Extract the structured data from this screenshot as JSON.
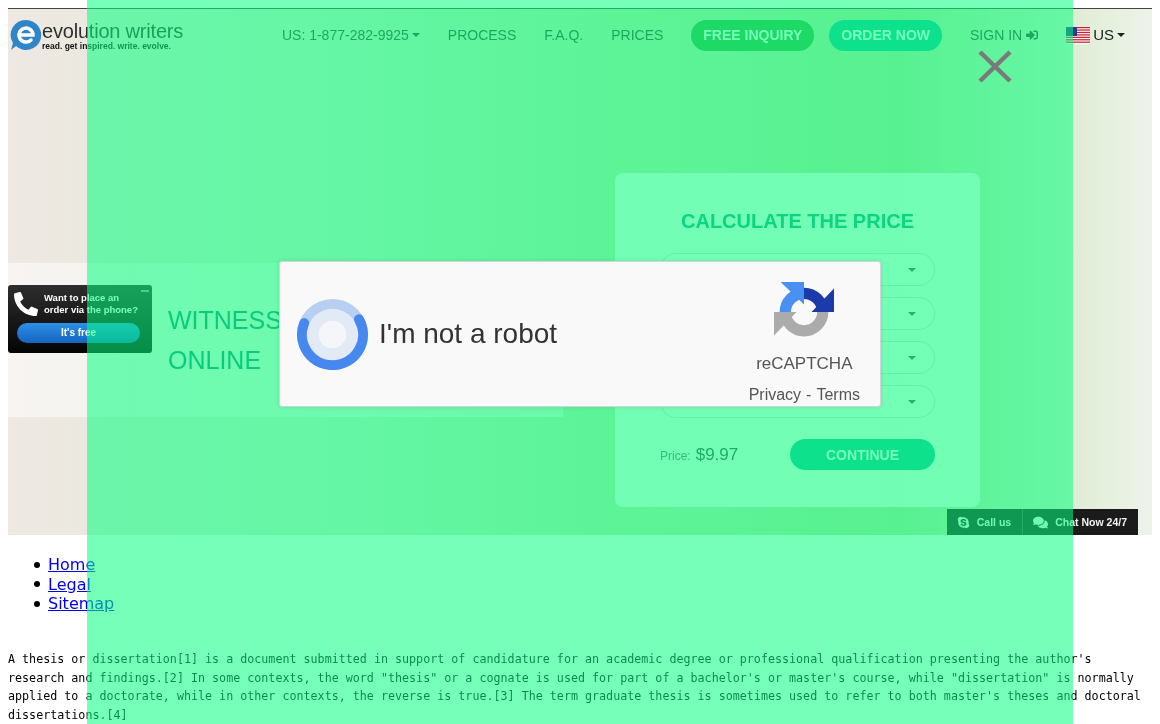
{
  "header": {
    "logo": {
      "title": "evolution writers",
      "tagline": "read. get inspired. write. evolve."
    },
    "phone": "US: 1-877-282-9925",
    "links": [
      "PROCESS",
      "F.A.Q.",
      "PRICES"
    ],
    "buttons": [
      {
        "label": "FREE INQUIRY",
        "kind": "inquiry"
      },
      {
        "label": "ORDER NOW",
        "kind": "order"
      }
    ],
    "sign_in": "SIGN IN",
    "locale": "US"
  },
  "hero": {
    "headline": [
      "WITNESS",
      "ONLINE"
    ]
  },
  "phone_widget": {
    "text": "Want to place an order via the phone?",
    "button": "It's free"
  },
  "calculator": {
    "title": "CALCULATE THE PRICE",
    "selects": [
      {
        "kind": "select"
      },
      {
        "kind": "select"
      },
      {
        "kind": "select"
      },
      {
        "kind": "select"
      }
    ],
    "price_label": "Price:",
    "price": "$9.97",
    "button": "CONTINUE"
  },
  "chat_bar": {
    "call": "Call us",
    "chat": "Chat Now 24/7"
  },
  "footer_links": [
    "Home",
    "Legal",
    "Sitemap"
  ],
  "article": "A thesis or dissertation[1] is a document submitted in support of candidature for an academic degree or professional qualification presenting the author's research and findings.[2] In some contexts, the word \"thesis\" or a cognate is used for part of a bachelor's or master's course, while \"dissertation\" is normally applied to a doctorate, while in other contexts, the reverse is true.[3] The term graduate thesis is sometimes used to refer to both master's theses and doctoral dissertations.[4]",
  "captcha": {
    "label": "I'm not a robot",
    "brand": "reCAPTCHA",
    "links": [
      "Privacy",
      "Terms"
    ],
    "separator": "-"
  }
}
